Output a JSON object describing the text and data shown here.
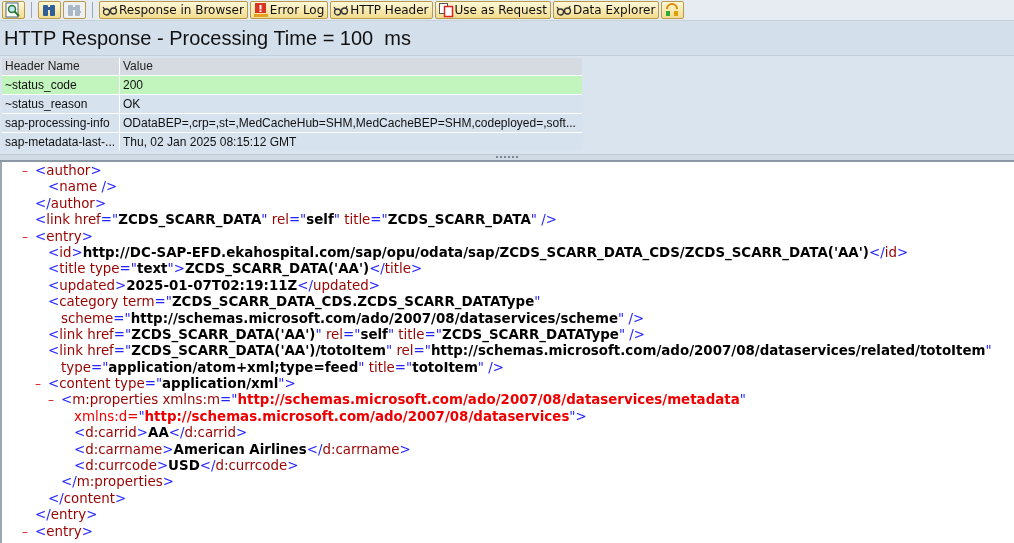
{
  "toolbar": [
    {
      "kind": "inspect",
      "disabled": false
    },
    {
      "kind": "find",
      "disabled": false
    },
    {
      "kind": "find-next",
      "disabled": true
    },
    {
      "kind": "glasses",
      "label": "Response in Browser",
      "disabled": false
    },
    {
      "kind": "error",
      "label": "Error Log",
      "disabled": false
    },
    {
      "kind": "glasses",
      "label": "HTTP Header",
      "disabled": false
    },
    {
      "kind": "copy",
      "label": "Use as Request",
      "disabled": false
    },
    {
      "kind": "glasses",
      "label": "Data Explorer",
      "disabled": false
    },
    {
      "kind": "toggle",
      "disabled": false
    }
  ],
  "title": "HTTP Response - Processing Time = 100  ms",
  "header_table": {
    "columns": [
      "Header Name",
      "Value"
    ],
    "rows": [
      {
        "name": "~status_code",
        "value": "200",
        "selected": true
      },
      {
        "name": "~status_reason",
        "value": "OK",
        "selected": false
      },
      {
        "name": "sap-processing-info",
        "value": "ODataBEP=,crp=,st=,MedCacheHub=SHM,MedCacheBEP=SHM,codeployed=,soft...",
        "selected": false
      },
      {
        "name": "sap-metadata-last-...",
        "value": "Thu, 02 Jan 2025 08:15:12 GMT",
        "selected": false
      }
    ]
  },
  "xml_tree": [
    {
      "toggle": "–",
      "expanded": true,
      "lines": [
        [
          {
            "kind": "punct",
            "text": "<"
          },
          {
            "kind": "name",
            "text": "author"
          },
          {
            "kind": "punct",
            "text": ">"
          }
        ]
      ],
      "children": [
        {
          "lines": [
            [
              {
                "kind": "punct",
                "text": "<"
              },
              {
                "kind": "name",
                "text": "name"
              },
              {
                "kind": "punct",
                "text": " />"
              }
            ]
          ]
        }
      ],
      "close": [
        {
          "kind": "punct",
          "text": "</"
        },
        {
          "kind": "name",
          "text": "author"
        },
        {
          "kind": "punct",
          "text": ">"
        }
      ]
    },
    {
      "lines": [
        [
          {
            "kind": "punct",
            "text": "<"
          },
          {
            "kind": "name",
            "text": "link"
          },
          {
            "kind": "name",
            "text": " href"
          },
          {
            "kind": "punct",
            "text": "=\""
          },
          {
            "kind": "value",
            "text": "ZCDS_SCARR_DATA"
          },
          {
            "kind": "punct",
            "text": "\""
          },
          {
            "kind": "name",
            "text": " rel"
          },
          {
            "kind": "punct",
            "text": "=\""
          },
          {
            "kind": "value",
            "text": "self"
          },
          {
            "kind": "punct",
            "text": "\""
          },
          {
            "kind": "name",
            "text": " title"
          },
          {
            "kind": "punct",
            "text": "=\""
          },
          {
            "kind": "value",
            "text": "ZCDS_SCARR_DATA"
          },
          {
            "kind": "punct",
            "text": "\" />"
          }
        ]
      ]
    },
    {
      "toggle": "–",
      "expanded": true,
      "lines": [
        [
          {
            "kind": "punct",
            "text": "<"
          },
          {
            "kind": "name",
            "text": "entry"
          },
          {
            "kind": "punct",
            "text": ">"
          }
        ]
      ],
      "children": [
        {
          "lines": [
            [
              {
                "kind": "punct",
                "text": "<"
              },
              {
                "kind": "name",
                "text": "id"
              },
              {
                "kind": "punct",
                "text": ">"
              },
              {
                "kind": "value",
                "text": "http://DC-SAP-EFD.ekahospital.com/sap/opu/odata/sap/ZCDS_SCARR_DATA_CDS/ZCDS_SCARR_DATA('AA')"
              },
              {
                "kind": "punct",
                "text": "</"
              },
              {
                "kind": "name",
                "text": "id"
              },
              {
                "kind": "punct",
                "text": ">"
              }
            ]
          ]
        },
        {
          "lines": [
            [
              {
                "kind": "punct",
                "text": "<"
              },
              {
                "kind": "name",
                "text": "title"
              },
              {
                "kind": "name",
                "text": " type"
              },
              {
                "kind": "punct",
                "text": "=\""
              },
              {
                "kind": "value",
                "text": "text"
              },
              {
                "kind": "punct",
                "text": "\">"
              },
              {
                "kind": "value",
                "text": "ZCDS_SCARR_DATA('AA')"
              },
              {
                "kind": "punct",
                "text": "</"
              },
              {
                "kind": "name",
                "text": "title"
              },
              {
                "kind": "punct",
                "text": ">"
              }
            ]
          ]
        },
        {
          "lines": [
            [
              {
                "kind": "punct",
                "text": "<"
              },
              {
                "kind": "name",
                "text": "updated"
              },
              {
                "kind": "punct",
                "text": ">"
              },
              {
                "kind": "value",
                "text": "2025-01-07T02:19:11Z"
              },
              {
                "kind": "punct",
                "text": "</"
              },
              {
                "kind": "name",
                "text": "updated"
              },
              {
                "kind": "punct",
                "text": ">"
              }
            ]
          ]
        },
        {
          "lines": [
            [
              {
                "kind": "punct",
                "text": "<"
              },
              {
                "kind": "name",
                "text": "category"
              },
              {
                "kind": "name",
                "text": " term"
              },
              {
                "kind": "punct",
                "text": "=\""
              },
              {
                "kind": "value",
                "text": "ZCDS_SCARR_DATA_CDS.ZCDS_SCARR_DATAType"
              },
              {
                "kind": "punct",
                "text": "\""
              }
            ],
            [
              {
                "kind": "name",
                "text": "scheme"
              },
              {
                "kind": "punct",
                "text": "=\""
              },
              {
                "kind": "value",
                "text": "http://schemas.microsoft.com/ado/2007/08/dataservices/scheme"
              },
              {
                "kind": "punct",
                "text": "\" />"
              }
            ]
          ]
        },
        {
          "lines": [
            [
              {
                "kind": "punct",
                "text": "<"
              },
              {
                "kind": "name",
                "text": "link"
              },
              {
                "kind": "name",
                "text": " href"
              },
              {
                "kind": "punct",
                "text": "=\""
              },
              {
                "kind": "value",
                "text": "ZCDS_SCARR_DATA('AA')"
              },
              {
                "kind": "punct",
                "text": "\""
              },
              {
                "kind": "name",
                "text": " rel"
              },
              {
                "kind": "punct",
                "text": "=\""
              },
              {
                "kind": "value",
                "text": "self"
              },
              {
                "kind": "punct",
                "text": "\""
              },
              {
                "kind": "name",
                "text": " title"
              },
              {
                "kind": "punct",
                "text": "=\""
              },
              {
                "kind": "value",
                "text": "ZCDS_SCARR_DATAType"
              },
              {
                "kind": "punct",
                "text": "\" />"
              }
            ]
          ]
        },
        {
          "lines": [
            [
              {
                "kind": "punct",
                "text": "<"
              },
              {
                "kind": "name",
                "text": "link"
              },
              {
                "kind": "name",
                "text": " href"
              },
              {
                "kind": "punct",
                "text": "=\""
              },
              {
                "kind": "value",
                "text": "ZCDS_SCARR_DATA('AA')/totoItem"
              },
              {
                "kind": "punct",
                "text": "\""
              },
              {
                "kind": "name",
                "text": " rel"
              },
              {
                "kind": "punct",
                "text": "=\""
              },
              {
                "kind": "value",
                "text": "http://schemas.microsoft.com/ado/2007/08/dataservices/related/totoItem"
              },
              {
                "kind": "punct",
                "text": "\""
              }
            ],
            [
              {
                "kind": "name",
                "text": "type"
              },
              {
                "kind": "punct",
                "text": "=\""
              },
              {
                "kind": "value",
                "text": "application/atom+xml;type=feed"
              },
              {
                "kind": "punct",
                "text": "\""
              },
              {
                "kind": "name",
                "text": " title"
              },
              {
                "kind": "punct",
                "text": "=\""
              },
              {
                "kind": "value",
                "text": "totoItem"
              },
              {
                "kind": "punct",
                "text": "\" />"
              }
            ]
          ]
        },
        {
          "toggle": "–",
          "expanded": true,
          "lines": [
            [
              {
                "kind": "punct",
                "text": "<"
              },
              {
                "kind": "name",
                "text": "content"
              },
              {
                "kind": "name",
                "text": " type"
              },
              {
                "kind": "punct",
                "text": "=\""
              },
              {
                "kind": "value",
                "text": "application/xml"
              },
              {
                "kind": "punct",
                "text": "\">"
              }
            ]
          ],
          "children": [
            {
              "toggle": "–",
              "expanded": true,
              "lines": [
                [
                  {
                    "kind": "punct",
                    "text": "<"
                  },
                  {
                    "kind": "name",
                    "text": "m:properties"
                  },
                  {
                    "kind": "name",
                    "text": " xmlns:m"
                  },
                  {
                    "kind": "punct",
                    "text": "=\""
                  },
                  {
                    "kind": "url",
                    "text": "http://schemas.microsoft.com/ado/2007/08/dataservices/metadata"
                  },
                  {
                    "kind": "punct",
                    "text": "\""
                  }
                ],
                [
                  {
                    "kind": "ns",
                    "text": "xmlns:d="
                  },
                  {
                    "kind": "punct",
                    "text": "\""
                  },
                  {
                    "kind": "url",
                    "text": "http://schemas.microsoft.com/ado/2007/08/dataservices"
                  },
                  {
                    "kind": "punct",
                    "text": "\">"
                  }
                ]
              ],
              "children": [
                {
                  "lines": [
                    [
                      {
                        "kind": "punct",
                        "text": "<"
                      },
                      {
                        "kind": "name",
                        "text": "d:carrid"
                      },
                      {
                        "kind": "punct",
                        "text": ">"
                      },
                      {
                        "kind": "value",
                        "text": "AA"
                      },
                      {
                        "kind": "punct",
                        "text": "</"
                      },
                      {
                        "kind": "name",
                        "text": "d:carrid"
                      },
                      {
                        "kind": "punct",
                        "text": ">"
                      }
                    ]
                  ]
                },
                {
                  "lines": [
                    [
                      {
                        "kind": "punct",
                        "text": "<"
                      },
                      {
                        "kind": "name",
                        "text": "d:carrname"
                      },
                      {
                        "kind": "punct",
                        "text": ">"
                      },
                      {
                        "kind": "value",
                        "text": "American Airlines"
                      },
                      {
                        "kind": "punct",
                        "text": "</"
                      },
                      {
                        "kind": "name",
                        "text": "d:carrname"
                      },
                      {
                        "kind": "punct",
                        "text": ">"
                      }
                    ]
                  ]
                },
                {
                  "lines": [
                    [
                      {
                        "kind": "punct",
                        "text": "<"
                      },
                      {
                        "kind": "name",
                        "text": "d:currcode"
                      },
                      {
                        "kind": "punct",
                        "text": ">"
                      },
                      {
                        "kind": "value",
                        "text": "USD"
                      },
                      {
                        "kind": "punct",
                        "text": "</"
                      },
                      {
                        "kind": "name",
                        "text": "d:currcode"
                      },
                      {
                        "kind": "punct",
                        "text": ">"
                      }
                    ]
                  ]
                }
              ],
              "close": [
                {
                  "kind": "punct",
                  "text": "</"
                },
                {
                  "kind": "name",
                  "text": "m:properties"
                },
                {
                  "kind": "punct",
                  "text": ">"
                }
              ]
            }
          ],
          "close": [
            {
              "kind": "punct",
              "text": "</"
            },
            {
              "kind": "name",
              "text": "content"
            },
            {
              "kind": "punct",
              "text": ">"
            }
          ]
        }
      ],
      "close": [
        {
          "kind": "punct",
          "text": "</"
        },
        {
          "kind": "name",
          "text": "entry"
        },
        {
          "kind": "punct",
          "text": ">"
        }
      ]
    },
    {
      "toggle": "–",
      "expanded": true,
      "lines": [
        [
          {
            "kind": "punct",
            "text": "<"
          },
          {
            "kind": "name",
            "text": "entry"
          },
          {
            "kind": "punct",
            "text": ">"
          }
        ]
      ]
    }
  ]
}
